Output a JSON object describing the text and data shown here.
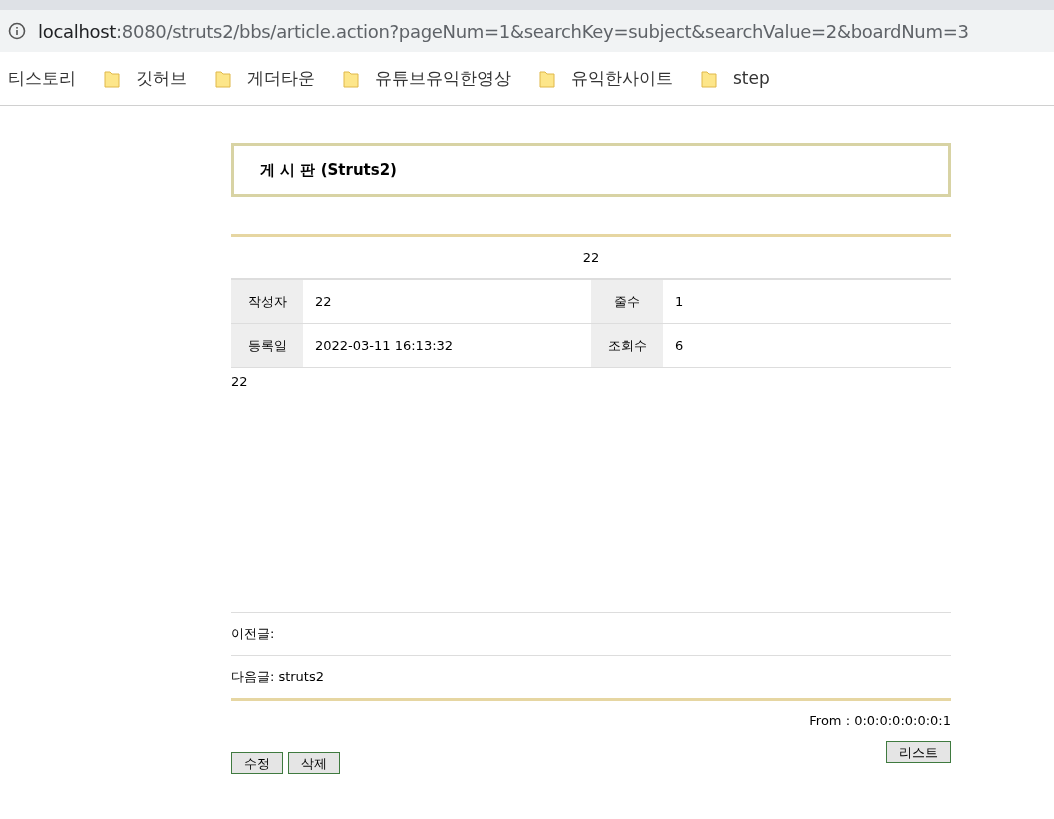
{
  "browser": {
    "url_host": "localhost",
    "url_path": ":8080/struts2/bbs/article.action?pageNum=1&searchKey=subject&searchValue=2&boardNum=3",
    "bookmarks": [
      {
        "label": "티스토리",
        "kind": "plain"
      },
      {
        "label": "깃허브",
        "kind": "folder"
      },
      {
        "label": "게더타운",
        "kind": "folder"
      },
      {
        "label": "유튜브유익한영상",
        "kind": "folder"
      },
      {
        "label": "유익한사이트",
        "kind": "folder"
      },
      {
        "label": "step",
        "kind": "folder"
      }
    ]
  },
  "board_title": "게 시 판 (Struts2)",
  "article": {
    "subject": "22",
    "info_rows": [
      [
        {
          "label": "작성자",
          "value": "22"
        },
        {
          "label": "줄수",
          "value": "1"
        }
      ],
      [
        {
          "label": "등록일",
          "value": "2022-03-11 16:13:32"
        },
        {
          "label": "조회수",
          "value": "6"
        }
      ]
    ],
    "content": "22",
    "prev": {
      "label": "이전글:"
    },
    "next": {
      "label": "다음글:",
      "title": "struts2"
    },
    "from": "From : 0:0:0:0:0:0:0:1"
  },
  "buttons_left": [
    "수정",
    "삭제"
  ],
  "buttons_right": [
    "리스트"
  ]
}
